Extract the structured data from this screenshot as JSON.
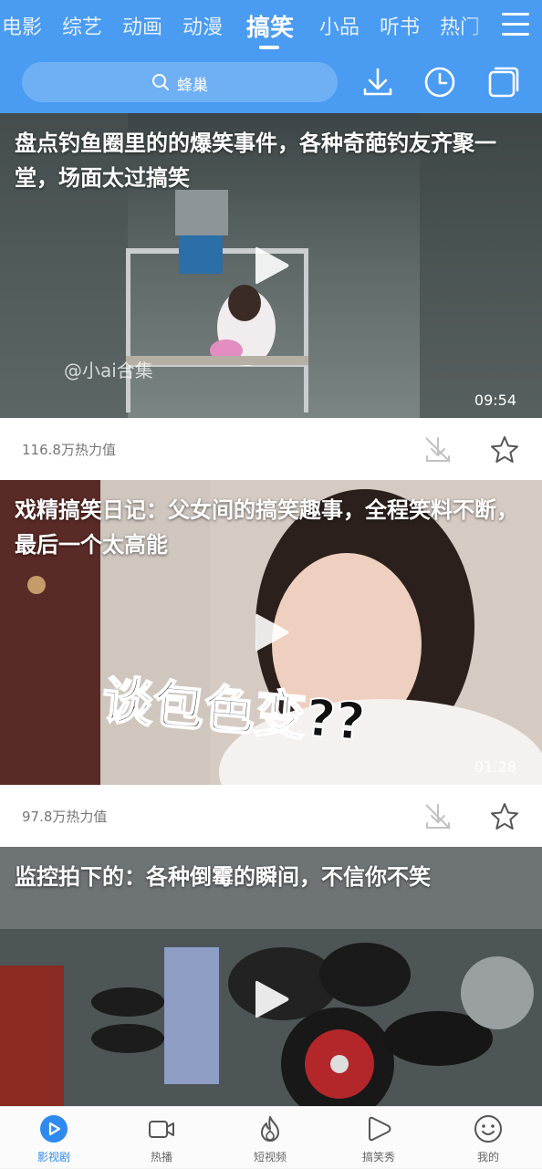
{
  "tabs": [
    "电影",
    "综艺",
    "动画",
    "动漫",
    "搞笑",
    "小品",
    "听书",
    "热门"
  ],
  "active_tab": "搞笑",
  "search": {
    "placeholder": "蜂巢"
  },
  "feed": [
    {
      "title": "盘点钓鱼圈里的的爆笑事件，各种奇葩钓友齐聚一堂，场面太过搞笑",
      "duration": "09:54",
      "heat": "116.8万热力值",
      "watermark": "@小ai合集"
    },
    {
      "title": "戏精搞笑日记：父女间的搞笑趣事，全程笑料不断，最后一个太高能",
      "duration": "01:28",
      "heat": "97.8万热力值",
      "caption": "谈包色变??"
    },
    {
      "title": "监控拍下的：各种倒霉的瞬间，不信你不笑"
    }
  ],
  "bottom_nav": [
    {
      "label": "影视剧",
      "icon": "play-circle-icon",
      "active": true
    },
    {
      "label": "热播",
      "icon": "video-camera-icon",
      "active": false
    },
    {
      "label": "短视频",
      "icon": "flame-icon",
      "active": false
    },
    {
      "label": "搞笑秀",
      "icon": "play-bubble-icon",
      "active": false
    },
    {
      "label": "我的",
      "icon": "smiley-icon",
      "active": false
    }
  ],
  "colors": {
    "accent": "#4a9bf2",
    "nav_active": "#2f8af0"
  }
}
